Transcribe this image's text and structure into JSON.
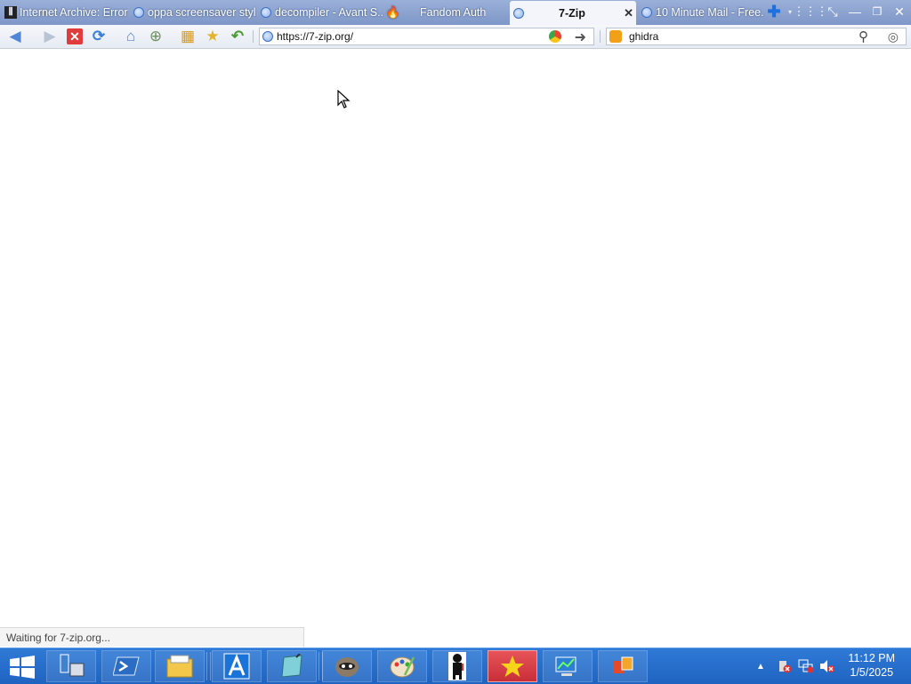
{
  "tabs": [
    {
      "label": "Internet Archive: Error",
      "icon": "internet-archive-icon"
    },
    {
      "label": "oppa screensaver styl...",
      "icon": "globe-icon"
    },
    {
      "label": "decompiler - Avant S...",
      "icon": "globe-icon"
    },
    {
      "label": "Fandom Auth",
      "icon": "flame-icon"
    },
    {
      "label": "7-Zip",
      "icon": "globe-icon",
      "active": true
    },
    {
      "label": "10 Minute Mail - Free...",
      "icon": "globe-icon"
    }
  ],
  "address_bar": {
    "url": "https://7-zip.org/"
  },
  "search_bar": {
    "query": "ghidra"
  },
  "status": {
    "text": "Waiting for 7-zip.org..."
  },
  "clock": {
    "time": "11:12 PM",
    "date": "1/5/2025"
  },
  "taskbar_apps": [
    "start",
    "server-manager",
    "powershell",
    "file-explorer",
    "app-a",
    "notepad-pen",
    "raccoon",
    "paint",
    "figure",
    "star-app",
    "network",
    "office"
  ],
  "colors": {
    "tabstrip": "#8aa2d2",
    "taskbar": "#2770cc",
    "active_task": "#d63a42"
  }
}
